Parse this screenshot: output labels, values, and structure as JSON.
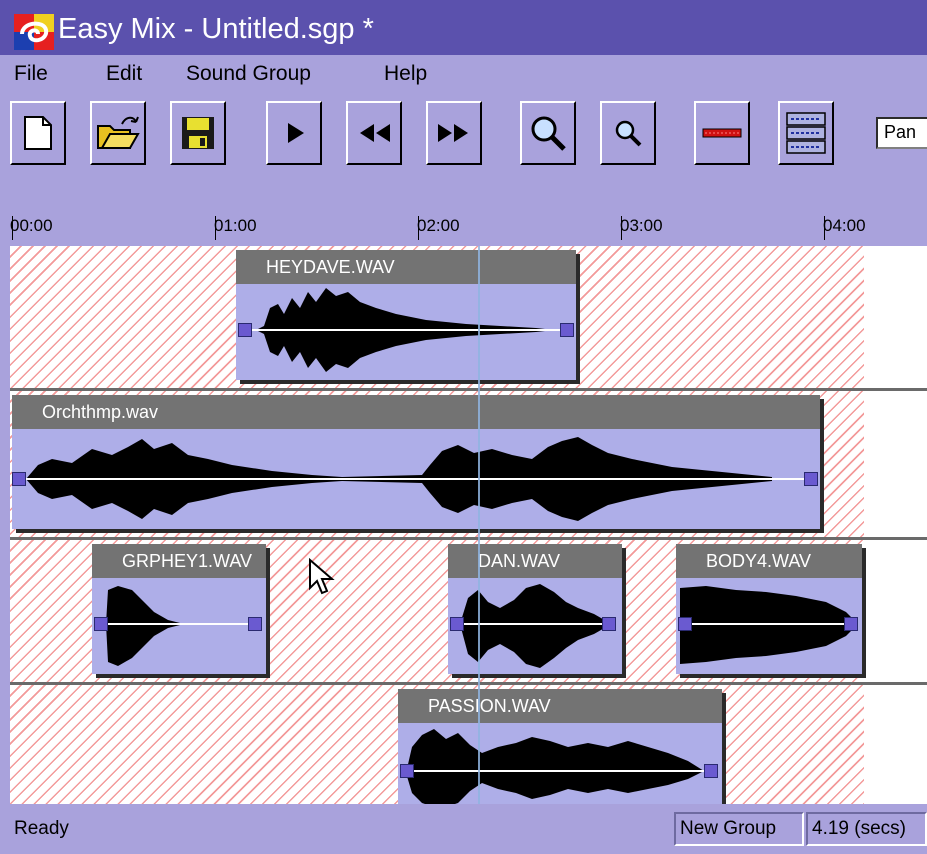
{
  "window": {
    "title": "Easy Mix - Untitled.sgp *"
  },
  "menu": [
    {
      "label": "File"
    },
    {
      "label": "Edit"
    },
    {
      "label": "Sound Group"
    },
    {
      "label": "Help"
    }
  ],
  "toolbar": {
    "buttons": [
      {
        "icon": "new-file-icon"
      },
      {
        "icon": "open-folder-icon"
      },
      {
        "icon": "save-disk-icon"
      },
      {
        "icon": "play-icon"
      },
      {
        "icon": "rewind-icon"
      },
      {
        "icon": "fast-forward-icon"
      },
      {
        "icon": "zoom-in-icon"
      },
      {
        "icon": "zoom-out-icon"
      },
      {
        "icon": "volume-line-icon"
      },
      {
        "icon": "mixer-panel-icon"
      }
    ],
    "mode_select": "Pan"
  },
  "ruler": {
    "ticks": [
      "00:00",
      "01:00",
      "02:00",
      "03:00",
      "04:00"
    ]
  },
  "tracks": [
    {
      "clips": [
        {
          "name": "HEYDAVE.WAV"
        }
      ]
    },
    {
      "clips": [
        {
          "name": "Orchthmp.wav"
        }
      ]
    },
    {
      "clips": [
        {
          "name": "GRPHEY1.WAV"
        },
        {
          "name": "DAN.WAV"
        },
        {
          "name": "BODY4.WAV"
        }
      ]
    },
    {
      "clips": [
        {
          "name": "PASSION.WAV"
        }
      ]
    }
  ],
  "colors": {
    "title_bar": "#5b51ad",
    "chrome": "#a9a2dc",
    "clip_body": "#aeaee8",
    "clip_header": "#737373",
    "hatch": "#f39a9a"
  },
  "status": {
    "text": "Ready",
    "group": "New Group",
    "duration": "4.19 (secs)"
  }
}
